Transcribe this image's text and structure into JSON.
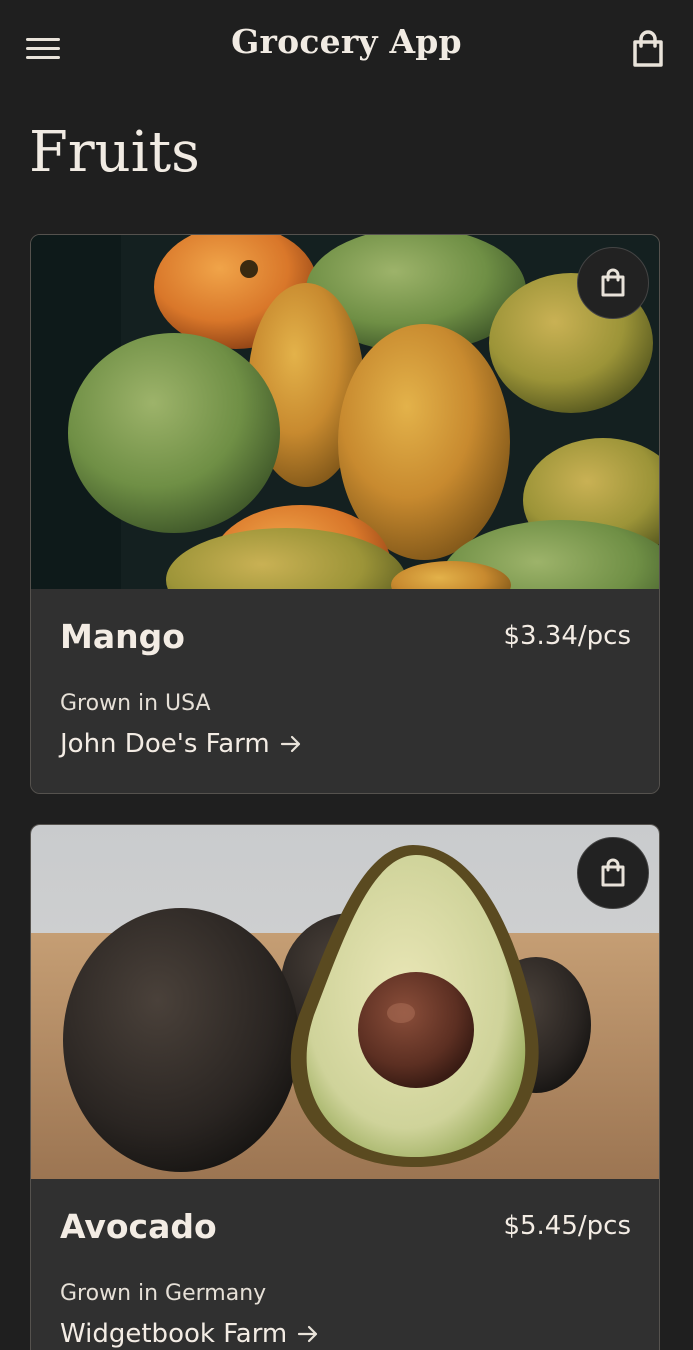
{
  "header": {
    "title": "Grocery App",
    "menu_icon": "hamburger-menu-icon",
    "cart_icon": "shopping-bag-icon"
  },
  "page": {
    "title": "Fruits"
  },
  "products": [
    {
      "name": "Mango",
      "price": "$3.34/pcs",
      "origin": "Grown in USA",
      "farm": "John Doe's Farm",
      "image": "mangoes-photo",
      "add_icon": "shopping-bag-icon"
    },
    {
      "name": "Avocado",
      "price": "$5.45/pcs",
      "origin": "Grown in Germany",
      "farm": "Widgetbook Farm",
      "image": "avocados-photo",
      "add_icon": "shopping-bag-icon"
    }
  ],
  "colors": {
    "background": "#1f1f1f",
    "card": "#303030",
    "text": "#f1ebe3"
  }
}
